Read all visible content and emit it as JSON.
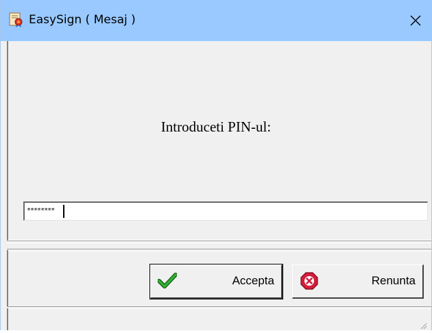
{
  "window": {
    "title": "EasySign ( Mesaj )",
    "app_icon": "certificate-icon",
    "close_icon": "close-icon"
  },
  "prompt": {
    "label": "Introduceti PIN-ul:"
  },
  "pin_field": {
    "masked_value": "********"
  },
  "buttons": {
    "accept": {
      "label": "Accepta",
      "icon": "checkmark-icon",
      "icon_color": "#1a8a1a"
    },
    "cancel": {
      "label": "Renunta",
      "icon": "cancel-icon",
      "icon_color": "#d21e3c"
    }
  },
  "colors": {
    "titlebar": "#99c9ff",
    "window_bg": "#f0f0f0"
  }
}
